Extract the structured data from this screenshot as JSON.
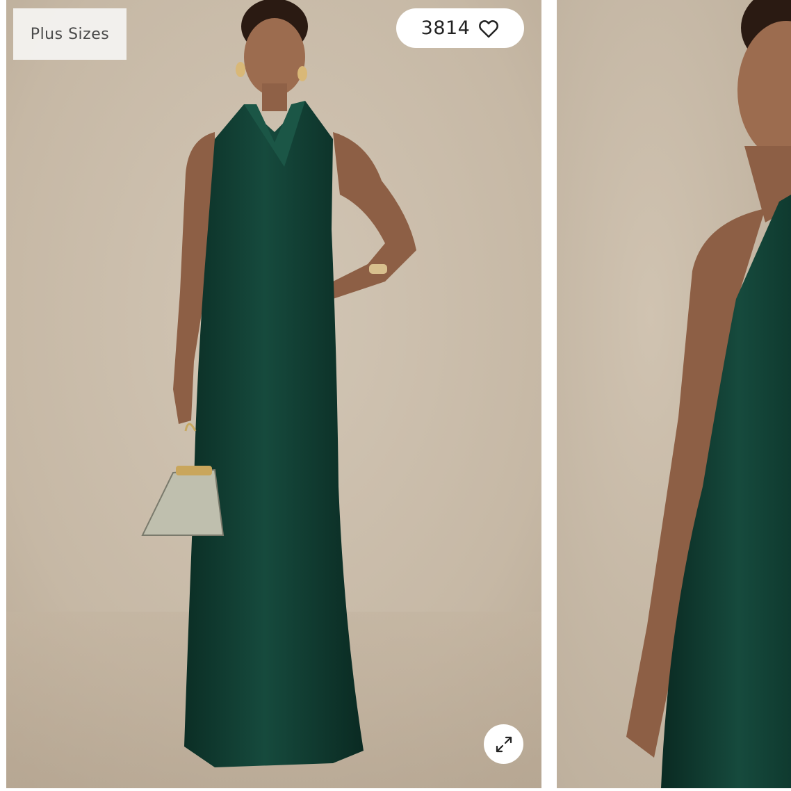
{
  "product_gallery": {
    "badge_label": "Plus Sizes",
    "favorite_count": "3814",
    "icons": {
      "favorite": "heart-outline-icon",
      "expand": "expand-arrows-icon"
    },
    "images": [
      {
        "name": "full-length-model-photo"
      },
      {
        "name": "close-up-model-photo"
      }
    ],
    "colors": {
      "backdrop": "#c9bba9",
      "dress": "#0f3a2f",
      "skin": "#9a6b4f",
      "pill_bg": "#ffffff",
      "badge_bg": "#f4f2ef"
    }
  }
}
